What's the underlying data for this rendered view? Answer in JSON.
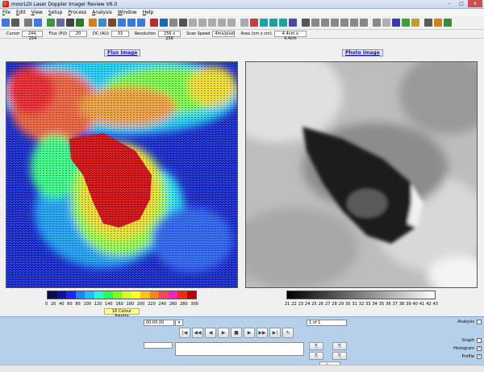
{
  "window": {
    "title": "moorLDI Laser Doppler Imager Review V6.0",
    "min": "–",
    "max": "□",
    "close": "x"
  },
  "menu": [
    {
      "label": "File",
      "u": "F",
      "rest": "ile"
    },
    {
      "label": "Edit",
      "u": "E",
      "rest": "dit"
    },
    {
      "label": "View",
      "u": "V",
      "rest": "iew"
    },
    {
      "label": "Setup",
      "u": "S",
      "rest": "etup"
    },
    {
      "label": "Process",
      "u": "P",
      "rest": "rocess"
    },
    {
      "label": "Analysis",
      "u": "A",
      "rest": "nalysis"
    },
    {
      "label": "Window",
      "u": "W",
      "rest": "indow"
    },
    {
      "label": "Help",
      "u": "H",
      "rest": "elp"
    }
  ],
  "toolbar": {
    "colors": [
      "#3a7bd5",
      "#5a5a5a",
      "#7a7a7a",
      "#3a7bd5",
      "#3a9a3a",
      "#6a6a9a",
      "#444",
      "#2a7a2a",
      "#d08020",
      "#3a8ad0",
      "#7a4a2a",
      "#3a7bd5",
      "#3a7bd5",
      "#3a7bd5",
      "#b03030",
      "#1a6ab0",
      "#888",
      "#555",
      "#aaa",
      "#aaa",
      "#aaa",
      "#aaa",
      "#aaa",
      "#aaa",
      "#c04040",
      "#20a0a0",
      "#20a0a0",
      "#20a0a0",
      "#4a4aa0",
      "#555",
      "#888",
      "#888",
      "#888",
      "#888",
      "#888",
      "#888",
      "#888",
      "#b0b0b0",
      "#3a3ab0",
      "#3aa03a",
      "#c0a030",
      "#5a5a5a",
      "#d08020",
      "#3a8a3a"
    ]
  },
  "status": {
    "cursor_label": "Cursor",
    "cursor_value": "244, 254",
    "flux_label": "Flux (PU)",
    "flux_value": "20",
    "dc_label": "DC (AU)",
    "dc_value": "33",
    "resolution_label": "Resolution",
    "resolution_value": "256 x 256",
    "scan_speed_label": "Scan Speed",
    "scan_speed_value": "4ms/pixel",
    "area_label": "Area (cm x cm)",
    "area_value": "4.4cm x 4.4cm"
  },
  "flux_panel": {
    "title": "Flux Image",
    "palette_name": "16 Colour Palette",
    "ticks": [
      "0",
      "20",
      "40",
      "60",
      "80",
      "100",
      "120",
      "140",
      "160",
      "180",
      "200",
      "220",
      "240",
      "260",
      "280",
      "300"
    ],
    "palette_colors": [
      "#0a0a50",
      "#1010a0",
      "#2020ff",
      "#2080ff",
      "#20c0ff",
      "#20ffd0",
      "#20ff60",
      "#80ff20",
      "#d0ff20",
      "#ffff20",
      "#ffc020",
      "#ff8020",
      "#ff4060",
      "#ff20c0",
      "#ff2020",
      "#c00000"
    ]
  },
  "photo_panel": {
    "title": "Photo Image",
    "ticks": [
      "21",
      "22",
      "23",
      "24",
      "25",
      "26",
      "27",
      "28",
      "29",
      "30",
      "31",
      "32",
      "33",
      "34",
      "35",
      "36",
      "37",
      "38",
      "39",
      "40",
      "41",
      "42",
      "43"
    ]
  },
  "playback": {
    "time": "00:00.00",
    "page": "1 of 1",
    "buttons": [
      "|◀",
      "◀◀",
      "◀",
      "▶",
      "■",
      "▶",
      "▶▶",
      "▶|",
      "↻"
    ],
    "side_buttons": [
      "⎘",
      "⎘",
      "⎘",
      "⎘",
      "⚲ …"
    ],
    "analysis_label": "Analysis",
    "graph_label": "Graph",
    "histogram_label": "Histogram",
    "profile_label": "Profile",
    "analysis_checked": false,
    "graph_checked": false,
    "histogram_checked": true,
    "profile_checked": true,
    "check_mark": "✓"
  }
}
